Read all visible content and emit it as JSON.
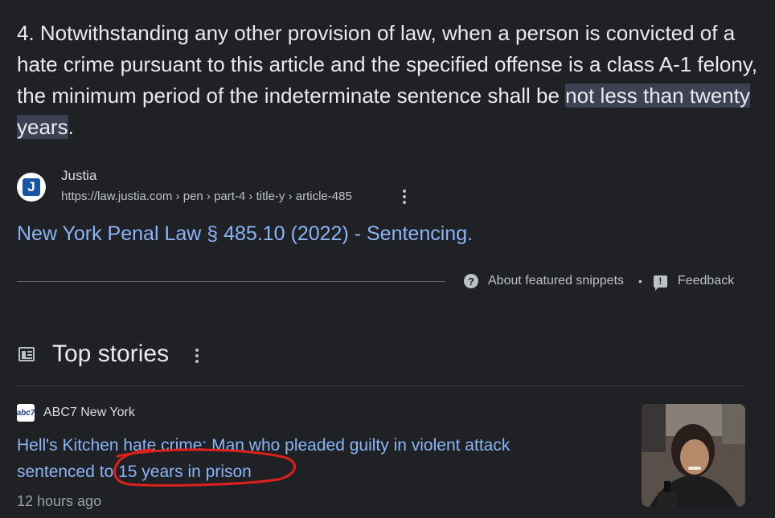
{
  "featured_snippet": {
    "text_before": "4. Notwithstanding any other provision of law, when a person is convicted of a hate crime pursuant to this article and the specified offense is a class A-1 felony, the minimum period of the indeterminate sentence shall be ",
    "text_highlight": "not less than twenty years",
    "text_after": ".",
    "source": {
      "favicon_letter": "J",
      "site_name": "Justia",
      "url": "https://law.justia.com › pen › part-4 › title-y › article-485",
      "title": "New York Penal Law § 485.10 (2022) - Sentencing."
    },
    "about_label": "About featured snippets",
    "separator": "•",
    "feedback_label": "Feedback"
  },
  "top_stories": {
    "heading": "Top stories",
    "stories": [
      {
        "publisher": "ABC7 New York",
        "publisher_logo_text": "abc7",
        "headline": "Hell's Kitchen hate crime: Man who pleaded guilty in violent attack sentenced to 15 years in prison",
        "time": "12 hours ago"
      }
    ]
  },
  "colors": {
    "background": "#202124",
    "text": "#e8eaed",
    "link": "#8ab4f8",
    "muted": "#bdc1c6",
    "highlight": "#3c4254",
    "annotation": "#e0201c"
  },
  "icons": {
    "about": "question-circle-icon",
    "feedback": "feedback-icon",
    "top_stories": "newspaper-icon",
    "menu": "more-vert-icon"
  }
}
